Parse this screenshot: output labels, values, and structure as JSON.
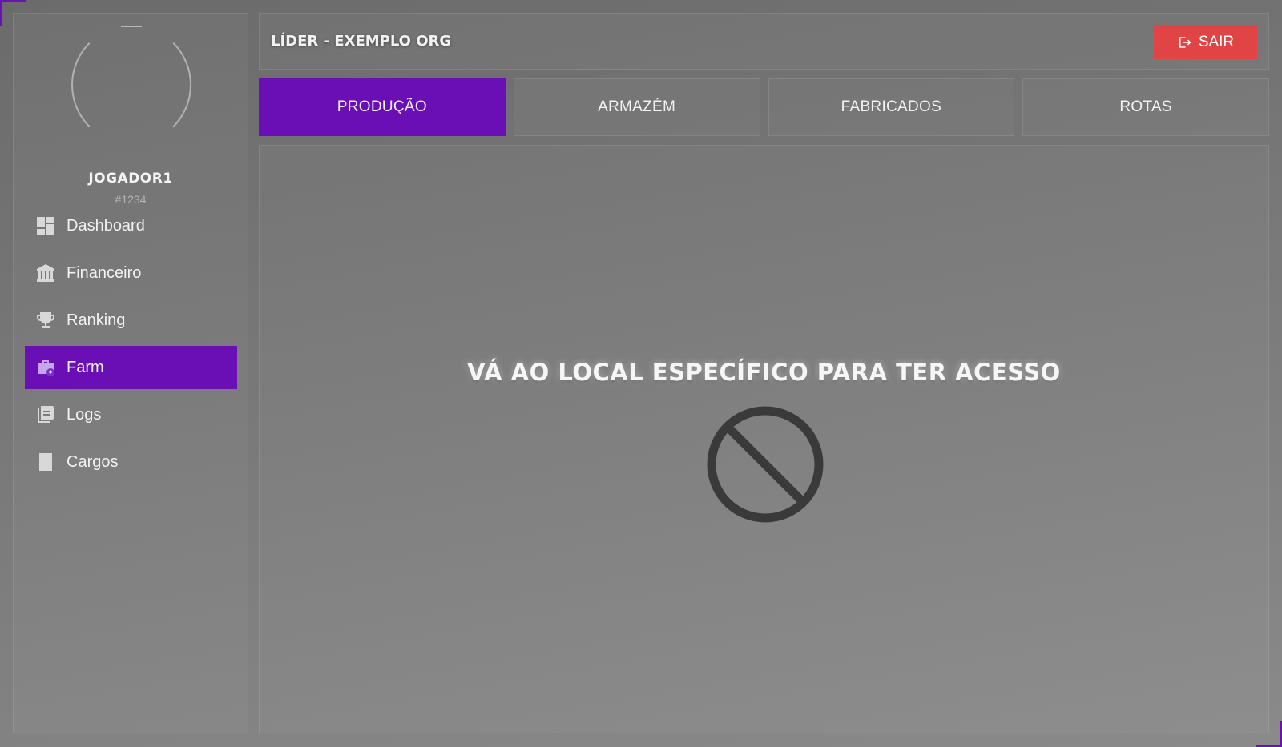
{
  "sidebar": {
    "username": "JOGADOR1",
    "user_id": "#1234",
    "items": [
      {
        "label": "Dashboard",
        "icon": "dashboard-icon",
        "active": false
      },
      {
        "label": "Financeiro",
        "icon": "bank-icon",
        "active": false
      },
      {
        "label": "Ranking",
        "icon": "trophy-icon",
        "active": false
      },
      {
        "label": "Farm",
        "icon": "briefcase-icon",
        "active": true
      },
      {
        "label": "Logs",
        "icon": "document-icon",
        "active": false
      },
      {
        "label": "Cargos",
        "icon": "book-icon",
        "active": false
      }
    ]
  },
  "header": {
    "title": "LÍDER - EXEMPLO ORG",
    "exit_label": "SAIR"
  },
  "tabs": [
    {
      "label": "PRODUÇÃO",
      "active": true
    },
    {
      "label": "ARMAZÉM",
      "active": false
    },
    {
      "label": "FABRICADOS",
      "active": false
    },
    {
      "label": "ROTAS",
      "active": false
    }
  ],
  "content": {
    "message": "VÁ AO LOCAL ESPECÍFICO PARA TER ACESSO",
    "icon": "blocked-icon"
  },
  "colors": {
    "accent": "#6a0fb5",
    "exit": "#e04444"
  }
}
